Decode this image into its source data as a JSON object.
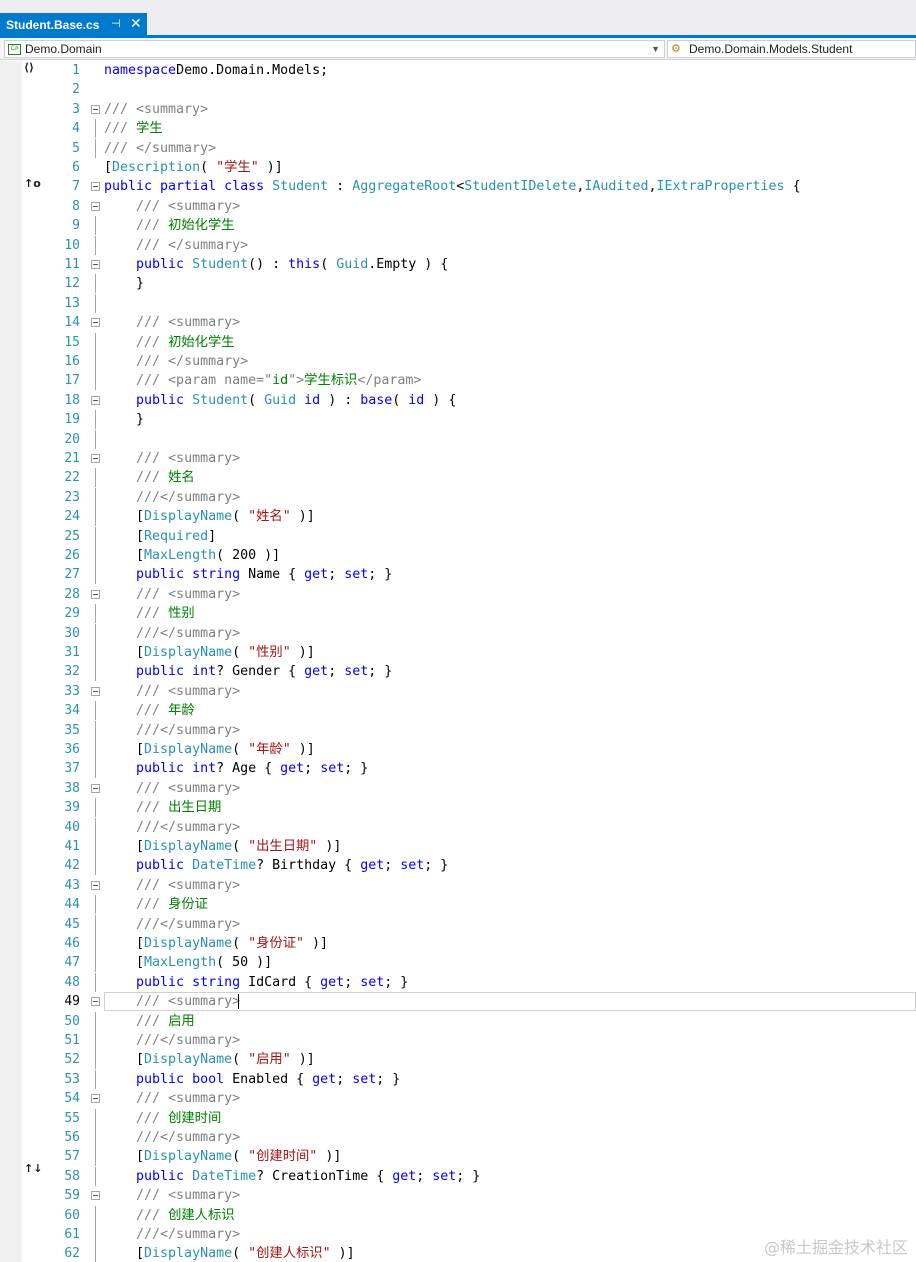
{
  "tab": {
    "title": "Student.Base.cs",
    "pin_icon": "pin-icon",
    "close_icon": "close-icon"
  },
  "navbar": {
    "project": "Demo.Domain",
    "member": "Demo.Domain.Models.Student"
  },
  "gutter": {
    "namespace_glyph": "⟨⟩",
    "implements_glyph": "↑o",
    "override_glyph": "↑↓"
  },
  "editor": {
    "current_line": 49
  },
  "watermark": "@稀土掘金技术社区",
  "lines": [
    {
      "n": 1,
      "fold": false,
      "guide": false,
      "tokens": [
        [
          "k",
          "namespace"
        ],
        [
          "",
          "Demo.Domain.Models;"
        ]
      ]
    },
    {
      "n": 2,
      "fold": false,
      "guide": false,
      "tokens": []
    },
    {
      "n": 3,
      "fold": true,
      "guide": false,
      "tokens": [
        [
          "cg",
          "/// <summary>"
        ]
      ]
    },
    {
      "n": 4,
      "fold": false,
      "guide": true,
      "tokens": [
        [
          "cg",
          "/// "
        ],
        [
          "c",
          "学生"
        ]
      ]
    },
    {
      "n": 5,
      "fold": false,
      "guide": true,
      "tokens": [
        [
          "cg",
          "/// </summary>"
        ]
      ]
    },
    {
      "n": 6,
      "fold": false,
      "guide": false,
      "tokens": [
        [
          "",
          "["
        ],
        [
          "t",
          "Description"
        ],
        [
          "",
          "( "
        ],
        [
          "s",
          "\"学生\""
        ],
        [
          "",
          " )]"
        ]
      ]
    },
    {
      "n": 7,
      "fold": true,
      "guide": false,
      "tokens": [
        [
          "k",
          "public partial class "
        ],
        [
          "t",
          "Student"
        ],
        [
          "",
          " : "
        ],
        [
          "t",
          "AggregateRoot"
        ],
        [
          "",
          "<"
        ],
        [
          "t",
          "Student"
        ],
        [
          ">,"
        ],
        [
          "t",
          "IDelete"
        ],
        [
          "",
          ","
        ],
        [
          "t",
          "IAudited"
        ],
        [
          "",
          ","
        ],
        [
          "t",
          "IExtraProperties"
        ],
        [
          "",
          " {"
        ]
      ]
    },
    {
      "n": 8,
      "fold": true,
      "guide": false,
      "tokens": [
        [
          "",
          "    "
        ],
        [
          "cg",
          "/// <summary>"
        ]
      ]
    },
    {
      "n": 9,
      "fold": false,
      "guide": true,
      "tokens": [
        [
          "",
          "    "
        ],
        [
          "cg",
          "/// "
        ],
        [
          "c",
          "初始化学生"
        ]
      ]
    },
    {
      "n": 10,
      "fold": false,
      "guide": true,
      "tokens": [
        [
          "",
          "    "
        ],
        [
          "cg",
          "/// </summary>"
        ]
      ]
    },
    {
      "n": 11,
      "fold": true,
      "guide": false,
      "tokens": [
        [
          "",
          "    "
        ],
        [
          "k",
          "public "
        ],
        [
          "t",
          "Student"
        ],
        [
          "",
          "() : "
        ],
        [
          "k",
          "this"
        ],
        [
          "",
          "( "
        ],
        [
          "t",
          "Guid"
        ],
        [
          "",
          ".Empty ) {"
        ]
      ]
    },
    {
      "n": 12,
      "fold": false,
      "guide": true,
      "tokens": [
        [
          "",
          "    }"
        ]
      ]
    },
    {
      "n": 13,
      "fold": false,
      "guide": true,
      "tokens": []
    },
    {
      "n": 14,
      "fold": true,
      "guide": false,
      "tokens": [
        [
          "",
          "    "
        ],
        [
          "cg",
          "/// <summary>"
        ]
      ]
    },
    {
      "n": 15,
      "fold": false,
      "guide": true,
      "tokens": [
        [
          "",
          "    "
        ],
        [
          "cg",
          "/// "
        ],
        [
          "c",
          "初始化学生"
        ]
      ]
    },
    {
      "n": 16,
      "fold": false,
      "guide": true,
      "tokens": [
        [
          "",
          "    "
        ],
        [
          "cg",
          "/// </summary>"
        ]
      ]
    },
    {
      "n": 17,
      "fold": false,
      "guide": true,
      "tokens": [
        [
          "",
          "    "
        ],
        [
          "cg",
          "/// <param name=\""
        ],
        [
          "c",
          "id"
        ],
        [
          "cg",
          "\">"
        ],
        [
          "c",
          "学生标识"
        ],
        [
          "cg",
          "</param>"
        ]
      ]
    },
    {
      "n": 18,
      "fold": true,
      "guide": false,
      "tokens": [
        [
          "",
          "    "
        ],
        [
          "k",
          "public "
        ],
        [
          "t",
          "Student"
        ],
        [
          "",
          "( "
        ],
        [
          "t",
          "Guid"
        ],
        [
          " ",
          ""
        ],
        [
          "k",
          " id"
        ],
        [
          "",
          " ) : "
        ],
        [
          "k",
          "base"
        ],
        [
          "",
          "( "
        ],
        [
          "k",
          "id"
        ],
        [
          "",
          " ) {"
        ]
      ]
    },
    {
      "n": 19,
      "fold": false,
      "guide": true,
      "tokens": [
        [
          "",
          "    }"
        ]
      ]
    },
    {
      "n": 20,
      "fold": false,
      "guide": true,
      "tokens": []
    },
    {
      "n": 21,
      "fold": true,
      "guide": false,
      "tokens": [
        [
          "",
          "    "
        ],
        [
          "cg",
          "/// <summary>"
        ]
      ]
    },
    {
      "n": 22,
      "fold": false,
      "guide": true,
      "tokens": [
        [
          "",
          "    "
        ],
        [
          "cg",
          "/// "
        ],
        [
          "c",
          "姓名"
        ]
      ]
    },
    {
      "n": 23,
      "fold": false,
      "guide": true,
      "tokens": [
        [
          "",
          "    "
        ],
        [
          "cg",
          "///</summary>"
        ]
      ]
    },
    {
      "n": 24,
      "fold": false,
      "guide": true,
      "tokens": [
        [
          "",
          "    ["
        ],
        [
          "t",
          "DisplayName"
        ],
        [
          "",
          "( "
        ],
        [
          "s",
          "\"姓名\""
        ],
        [
          "",
          " )]"
        ]
      ]
    },
    {
      "n": 25,
      "fold": false,
      "guide": true,
      "tokens": [
        [
          "",
          "    ["
        ],
        [
          "t",
          "Required"
        ],
        [
          "",
          "]"
        ]
      ]
    },
    {
      "n": 26,
      "fold": false,
      "guide": true,
      "tokens": [
        [
          "",
          "    ["
        ],
        [
          "t",
          "MaxLength"
        ],
        [
          "",
          "( 200 )]"
        ]
      ]
    },
    {
      "n": 27,
      "fold": false,
      "guide": true,
      "tokens": [
        [
          "",
          "    "
        ],
        [
          "k",
          "public string "
        ],
        [
          "",
          "Name { "
        ],
        [
          "k",
          "get"
        ],
        [
          "",
          "; "
        ],
        [
          "k",
          "set"
        ],
        [
          "",
          "; }"
        ]
      ]
    },
    {
      "n": 28,
      "fold": true,
      "guide": false,
      "tokens": [
        [
          "",
          "    "
        ],
        [
          "cg",
          "/// <summary>"
        ]
      ]
    },
    {
      "n": 29,
      "fold": false,
      "guide": true,
      "tokens": [
        [
          "",
          "    "
        ],
        [
          "cg",
          "/// "
        ],
        [
          "c",
          "性别"
        ]
      ]
    },
    {
      "n": 30,
      "fold": false,
      "guide": true,
      "tokens": [
        [
          "",
          "    "
        ],
        [
          "cg",
          "///</summary>"
        ]
      ]
    },
    {
      "n": 31,
      "fold": false,
      "guide": true,
      "tokens": [
        [
          "",
          "    ["
        ],
        [
          "t",
          "DisplayName"
        ],
        [
          "",
          "( "
        ],
        [
          "s",
          "\"性别\""
        ],
        [
          "",
          " )]"
        ]
      ]
    },
    {
      "n": 32,
      "fold": false,
      "guide": true,
      "tokens": [
        [
          "",
          "    "
        ],
        [
          "k",
          "public int"
        ],
        [
          "",
          "? Gender { "
        ],
        [
          "k",
          "get"
        ],
        [
          "",
          "; "
        ],
        [
          "k",
          "set"
        ],
        [
          "",
          "; }"
        ]
      ]
    },
    {
      "n": 33,
      "fold": true,
      "guide": false,
      "tokens": [
        [
          "",
          "    "
        ],
        [
          "cg",
          "/// <summary>"
        ]
      ]
    },
    {
      "n": 34,
      "fold": false,
      "guide": true,
      "tokens": [
        [
          "",
          "    "
        ],
        [
          "cg",
          "/// "
        ],
        [
          "c",
          "年龄"
        ]
      ]
    },
    {
      "n": 35,
      "fold": false,
      "guide": true,
      "tokens": [
        [
          "",
          "    "
        ],
        [
          "cg",
          "///</summary>"
        ]
      ]
    },
    {
      "n": 36,
      "fold": false,
      "guide": true,
      "tokens": [
        [
          "",
          "    ["
        ],
        [
          "t",
          "DisplayName"
        ],
        [
          "",
          "( "
        ],
        [
          "s",
          "\"年龄\""
        ],
        [
          "",
          " )]"
        ]
      ]
    },
    {
      "n": 37,
      "fold": false,
      "guide": true,
      "tokens": [
        [
          "",
          "    "
        ],
        [
          "k",
          "public int"
        ],
        [
          "",
          "? Age { "
        ],
        [
          "k",
          "get"
        ],
        [
          "",
          "; "
        ],
        [
          "k",
          "set"
        ],
        [
          "",
          "; }"
        ]
      ]
    },
    {
      "n": 38,
      "fold": true,
      "guide": false,
      "tokens": [
        [
          "",
          "    "
        ],
        [
          "cg",
          "/// <summary>"
        ]
      ]
    },
    {
      "n": 39,
      "fold": false,
      "guide": true,
      "tokens": [
        [
          "",
          "    "
        ],
        [
          "cg",
          "/// "
        ],
        [
          "c",
          "出生日期"
        ]
      ]
    },
    {
      "n": 40,
      "fold": false,
      "guide": true,
      "tokens": [
        [
          "",
          "    "
        ],
        [
          "cg",
          "///</summary>"
        ]
      ]
    },
    {
      "n": 41,
      "fold": false,
      "guide": true,
      "tokens": [
        [
          "",
          "    ["
        ],
        [
          "t",
          "DisplayName"
        ],
        [
          "",
          "( "
        ],
        [
          "s",
          "\"出生日期\""
        ],
        [
          "",
          " )]"
        ]
      ]
    },
    {
      "n": 42,
      "fold": false,
      "guide": true,
      "tokens": [
        [
          "",
          "    "
        ],
        [
          "k",
          "public "
        ],
        [
          "t",
          "DateTime"
        ],
        [
          "",
          "? Birthday { "
        ],
        [
          "k",
          "get"
        ],
        [
          "",
          "; "
        ],
        [
          "k",
          "set"
        ],
        [
          "",
          "; }"
        ]
      ]
    },
    {
      "n": 43,
      "fold": true,
      "guide": false,
      "tokens": [
        [
          "",
          "    "
        ],
        [
          "cg",
          "/// <summary>"
        ]
      ]
    },
    {
      "n": 44,
      "fold": false,
      "guide": true,
      "tokens": [
        [
          "",
          "    "
        ],
        [
          "cg",
          "/// "
        ],
        [
          "c",
          "身份证"
        ]
      ]
    },
    {
      "n": 45,
      "fold": false,
      "guide": true,
      "tokens": [
        [
          "",
          "    "
        ],
        [
          "cg",
          "///</summary>"
        ]
      ]
    },
    {
      "n": 46,
      "fold": false,
      "guide": true,
      "tokens": [
        [
          "",
          "    ["
        ],
        [
          "t",
          "DisplayName"
        ],
        [
          "",
          "( "
        ],
        [
          "s",
          "\"身份证\""
        ],
        [
          "",
          " )]"
        ]
      ]
    },
    {
      "n": 47,
      "fold": false,
      "guide": true,
      "tokens": [
        [
          "",
          "    ["
        ],
        [
          "t",
          "MaxLength"
        ],
        [
          "",
          "( 50 )]"
        ]
      ]
    },
    {
      "n": 48,
      "fold": false,
      "guide": true,
      "tokens": [
        [
          "",
          "    "
        ],
        [
          "k",
          "public string "
        ],
        [
          "",
          "IdCard { "
        ],
        [
          "k",
          "get"
        ],
        [
          "",
          "; "
        ],
        [
          "k",
          "set"
        ],
        [
          "",
          "; }"
        ]
      ]
    },
    {
      "n": 49,
      "fold": true,
      "guide": false,
      "tokens": [
        [
          "",
          "    "
        ],
        [
          "cg",
          "/// <summary>"
        ]
      ]
    },
    {
      "n": 50,
      "fold": false,
      "guide": true,
      "tokens": [
        [
          "",
          "    "
        ],
        [
          "cg",
          "/// "
        ],
        [
          "c",
          "启用"
        ]
      ]
    },
    {
      "n": 51,
      "fold": false,
      "guide": true,
      "tokens": [
        [
          "",
          "    "
        ],
        [
          "cg",
          "///</summary>"
        ]
      ]
    },
    {
      "n": 52,
      "fold": false,
      "guide": true,
      "tokens": [
        [
          "",
          "    ["
        ],
        [
          "t",
          "DisplayName"
        ],
        [
          "",
          "( "
        ],
        [
          "s",
          "\"启用\""
        ],
        [
          "",
          " )]"
        ]
      ]
    },
    {
      "n": 53,
      "fold": false,
      "guide": true,
      "tokens": [
        [
          "",
          "    "
        ],
        [
          "k",
          "public bool "
        ],
        [
          "",
          "Enabled { "
        ],
        [
          "k",
          "get"
        ],
        [
          "",
          "; "
        ],
        [
          "k",
          "set"
        ],
        [
          "",
          "; }"
        ]
      ]
    },
    {
      "n": 54,
      "fold": true,
      "guide": false,
      "tokens": [
        [
          "",
          "    "
        ],
        [
          "cg",
          "/// <summary>"
        ]
      ]
    },
    {
      "n": 55,
      "fold": false,
      "guide": true,
      "tokens": [
        [
          "",
          "    "
        ],
        [
          "cg",
          "/// "
        ],
        [
          "c",
          "创建时间"
        ]
      ]
    },
    {
      "n": 56,
      "fold": false,
      "guide": true,
      "tokens": [
        [
          "",
          "    "
        ],
        [
          "cg",
          "///</summary>"
        ]
      ]
    },
    {
      "n": 57,
      "fold": false,
      "guide": true,
      "tokens": [
        [
          "",
          "    ["
        ],
        [
          "t",
          "DisplayName"
        ],
        [
          "",
          "( "
        ],
        [
          "s",
          "\"创建时间\""
        ],
        [
          "",
          " )]"
        ]
      ]
    },
    {
      "n": 58,
      "fold": false,
      "guide": true,
      "tokens": [
        [
          "",
          "    "
        ],
        [
          "k",
          "public "
        ],
        [
          "t",
          "DateTime"
        ],
        [
          "",
          "? CreationTime { "
        ],
        [
          "k",
          "get"
        ],
        [
          "",
          "; "
        ],
        [
          "k",
          "set"
        ],
        [
          "",
          "; }"
        ]
      ]
    },
    {
      "n": 59,
      "fold": true,
      "guide": false,
      "tokens": [
        [
          "",
          "    "
        ],
        [
          "cg",
          "/// <summary>"
        ]
      ]
    },
    {
      "n": 60,
      "fold": false,
      "guide": true,
      "tokens": [
        [
          "",
          "    "
        ],
        [
          "cg",
          "/// "
        ],
        [
          "c",
          "创建人标识"
        ]
      ]
    },
    {
      "n": 61,
      "fold": false,
      "guide": true,
      "tokens": [
        [
          "",
          "    "
        ],
        [
          "cg",
          "///</summary>"
        ]
      ]
    },
    {
      "n": 62,
      "fold": false,
      "guide": true,
      "tokens": [
        [
          "",
          "    ["
        ],
        [
          "t",
          "DisplayName"
        ],
        [
          "",
          "( "
        ],
        [
          "s",
          "\"创建人标识\""
        ],
        [
          "",
          " )]"
        ]
      ]
    }
  ]
}
